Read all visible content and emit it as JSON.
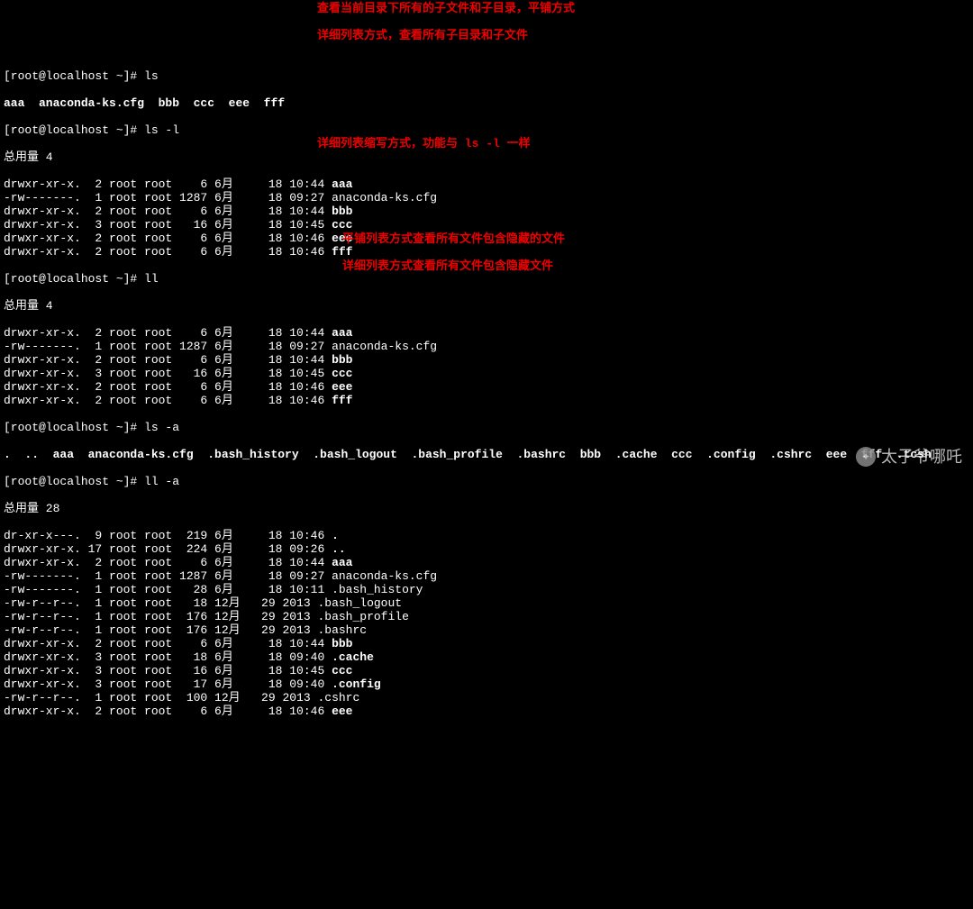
{
  "prompt": "[root@localhost ~]# ",
  "cmd1": "ls",
  "ls_out": "aaa  anaconda-ks.cfg  bbb  ccc  eee  fff",
  "anno1": "查看当前目录下所有的子文件和子目录，平铺方式",
  "cmd2": "ls -l",
  "anno2": "详细列表方式，查看所有子目录和子文件",
  "total1": "总用量 4",
  "lsl": [
    {
      "perm": "drwxr-xr-x.",
      "n": "2",
      "u": "root",
      "g": "root",
      "sz": "   6",
      "m": "6月",
      "d": "  18",
      "t": "10:44",
      "name": "aaa",
      "b": true
    },
    {
      "perm": "-rw-------.",
      "n": "1",
      "u": "root",
      "g": "root",
      "sz": "1287",
      "m": "6月",
      "d": "  18",
      "t": "09:27",
      "name": "anaconda-ks.cfg",
      "b": false
    },
    {
      "perm": "drwxr-xr-x.",
      "n": "2",
      "u": "root",
      "g": "root",
      "sz": "   6",
      "m": "6月",
      "d": "  18",
      "t": "10:44",
      "name": "bbb",
      "b": true
    },
    {
      "perm": "drwxr-xr-x.",
      "n": "3",
      "u": "root",
      "g": "root",
      "sz": "  16",
      "m": "6月",
      "d": "  18",
      "t": "10:45",
      "name": "ccc",
      "b": true
    },
    {
      "perm": "drwxr-xr-x.",
      "n": "2",
      "u": "root",
      "g": "root",
      "sz": "   6",
      "m": "6月",
      "d": "  18",
      "t": "10:46",
      "name": "eee",
      "b": true
    },
    {
      "perm": "drwxr-xr-x.",
      "n": "2",
      "u": "root",
      "g": "root",
      "sz": "   6",
      "m": "6月",
      "d": "  18",
      "t": "10:46",
      "name": "fff",
      "b": true
    }
  ],
  "cmd3": "ll",
  "anno3": "详细列表缩写方式，功能与 ls -l 一样",
  "total2": "总用量 4",
  "cmd4": "ls -a",
  "anno4": "平铺列表方式查看所有文件包含隐藏的文件",
  "lsa_out": ".  ..  aaa  anaconda-ks.cfg  .bash_history  .bash_logout  .bash_profile  .bashrc  bbb  .cache  ccc  .config  .cshrc  eee  fff  .tcsh",
  "cmd5": "ll -a",
  "anno5": "详细列表方式查看所有文件包含隐藏文件",
  "total3": "总用量 28",
  "lla": [
    {
      "perm": "dr-xr-x---.",
      "n": " 9",
      "u": "root",
      "g": "root",
      "sz": " 219",
      "m": "6月",
      "d": "  18",
      "t": "10:46",
      "name": ".",
      "b": true
    },
    {
      "perm": "drwxr-xr-x.",
      "n": "17",
      "u": "root",
      "g": "root",
      "sz": " 224",
      "m": "6月",
      "d": "  18",
      "t": "09:26",
      "name": "..",
      "b": true
    },
    {
      "perm": "drwxr-xr-x.",
      "n": " 2",
      "u": "root",
      "g": "root",
      "sz": "   6",
      "m": "6月",
      "d": "  18",
      "t": "10:44",
      "name": "aaa",
      "b": true
    },
    {
      "perm": "-rw-------.",
      "n": " 1",
      "u": "root",
      "g": "root",
      "sz": "1287",
      "m": "6月",
      "d": "  18",
      "t": "09:27",
      "name": "anaconda-ks.cfg",
      "b": false
    },
    {
      "perm": "-rw-------.",
      "n": " 1",
      "u": "root",
      "g": "root",
      "sz": "  28",
      "m": "6月",
      "d": "  18",
      "t": "10:11",
      "name": ".bash_history",
      "b": false
    },
    {
      "perm": "-rw-r--r--.",
      "n": " 1",
      "u": "root",
      "g": "root",
      "sz": "  18",
      "m": "12月",
      "d": " 29",
      "t": "2013",
      "name": ".bash_logout",
      "b": false
    },
    {
      "perm": "-rw-r--r--.",
      "n": " 1",
      "u": "root",
      "g": "root",
      "sz": " 176",
      "m": "12月",
      "d": " 29",
      "t": "2013",
      "name": ".bash_profile",
      "b": false
    },
    {
      "perm": "-rw-r--r--.",
      "n": " 1",
      "u": "root",
      "g": "root",
      "sz": " 176",
      "m": "12月",
      "d": " 29",
      "t": "2013",
      "name": ".bashrc",
      "b": false
    },
    {
      "perm": "drwxr-xr-x.",
      "n": " 2",
      "u": "root",
      "g": "root",
      "sz": "   6",
      "m": "6月",
      "d": "  18",
      "t": "10:44",
      "name": "bbb",
      "b": true
    },
    {
      "perm": "drwxr-xr-x.",
      "n": " 3",
      "u": "root",
      "g": "root",
      "sz": "  18",
      "m": "6月",
      "d": "  18",
      "t": "09:40",
      "name": ".cache",
      "b": true
    },
    {
      "perm": "drwxr-xr-x.",
      "n": " 3",
      "u": "root",
      "g": "root",
      "sz": "  16",
      "m": "6月",
      "d": "  18",
      "t": "10:45",
      "name": "ccc",
      "b": true
    },
    {
      "perm": "drwxr-xr-x.",
      "n": " 3",
      "u": "root",
      "g": "root",
      "sz": "  17",
      "m": "6月",
      "d": "  18",
      "t": "09:40",
      "name": ".config",
      "b": true
    },
    {
      "perm": "-rw-r--r--.",
      "n": " 1",
      "u": "root",
      "g": "root",
      "sz": " 100",
      "m": "12月",
      "d": " 29",
      "t": "2013",
      "name": ".cshrc",
      "b": false
    },
    {
      "perm": "drwxr-xr-x.",
      "n": " 2",
      "u": "root",
      "g": "root",
      "sz": "   6",
      "m": "6月",
      "d": "  18",
      "t": "10:46",
      "name": "eee",
      "b": true
    }
  ],
  "watermark": "太子爷哪吒"
}
